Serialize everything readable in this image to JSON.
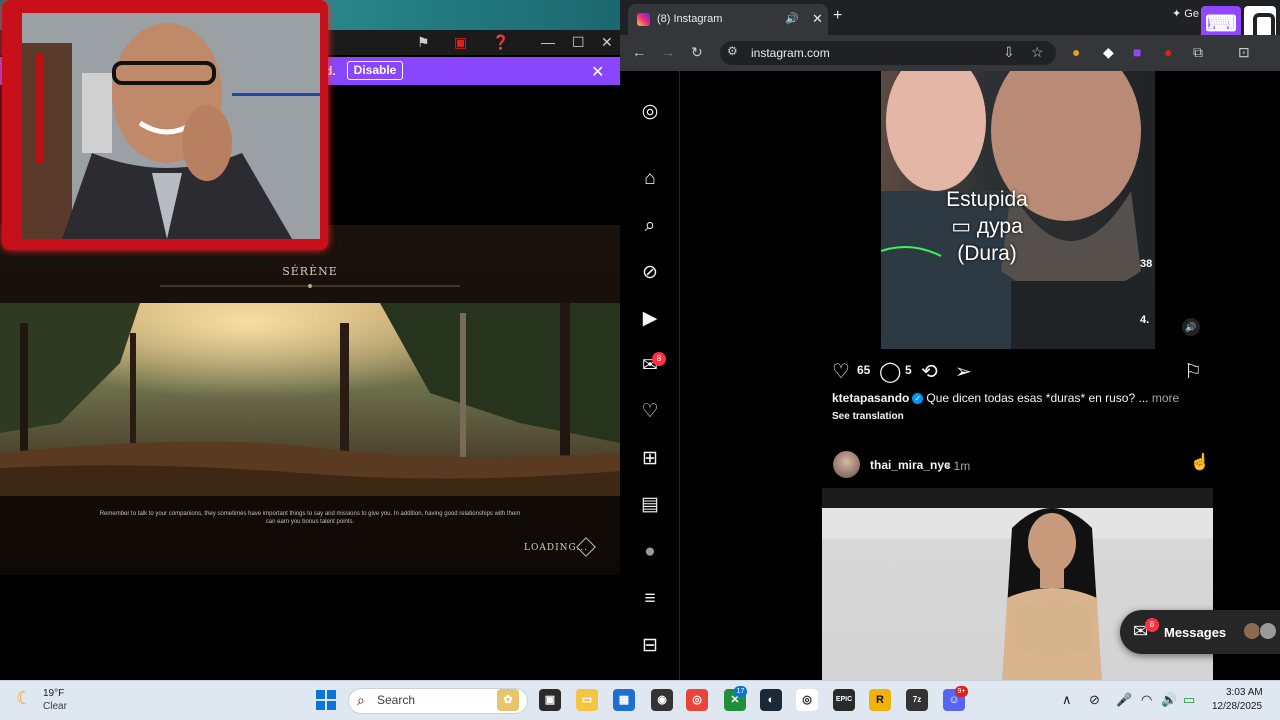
{
  "game": {
    "banner_text": "d.",
    "disable_label": "Disable",
    "area_name": "SÉRÈNE",
    "tip_text": "Remember to talk to your companions, they sometimes have important things to say and missions to give you. In addition, having good relationships with them can earn you bonus talent points.",
    "loading_label": "LOADING..."
  },
  "browser": {
    "tab_title": "(8) Instagram",
    "url": "instagram.com",
    "gemini_label": "Ge"
  },
  "instagram": {
    "nav_badge": "8",
    "video_caption_line1": "Estupida",
    "video_caption_line2": "дура",
    "video_caption_line3": "(Dura)",
    "video_side_count1": "38",
    "video_side_count2": "4.",
    "likes": "65",
    "comments": "5",
    "post_user": "ktetapasando",
    "post_caption": "Que dicen todas esas *duras* en ruso? ...",
    "more_label": "more",
    "see_translation": "See translation",
    "post2_user": "thai_mira_nyc",
    "post2_time": "• 1m",
    "messages_label": "Messages",
    "messages_badge": "8"
  },
  "taskbar": {
    "weather_temp": "19°F",
    "weather_desc": "Clear",
    "search_placeholder": "Search",
    "badge_xbox": "17",
    "badge_discord": "9+",
    "time": "3:03 AM",
    "date": "12/28/2025"
  },
  "colors": {
    "twitch": "#9146ff",
    "instagram_bg": "#000000",
    "badge_red": "#ff3040",
    "webcam_border": "#c8101a"
  }
}
